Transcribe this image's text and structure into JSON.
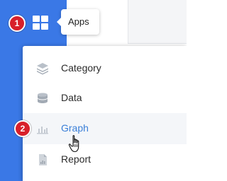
{
  "top_menu": {
    "apps_label": "Apps"
  },
  "menu": {
    "items": [
      {
        "label": "Category",
        "icon": "layers-icon"
      },
      {
        "label": "Data",
        "icon": "database-icon"
      },
      {
        "label": "Graph",
        "icon": "bar-chart-icon"
      },
      {
        "label": "Report",
        "icon": "document-icon"
      }
    ],
    "active_item": "Graph"
  },
  "steps": [
    "1",
    "2"
  ],
  "colors": {
    "sidebar": "#3a78e6",
    "step_marker": "#d8202a",
    "active_text": "#3a7fd8"
  }
}
